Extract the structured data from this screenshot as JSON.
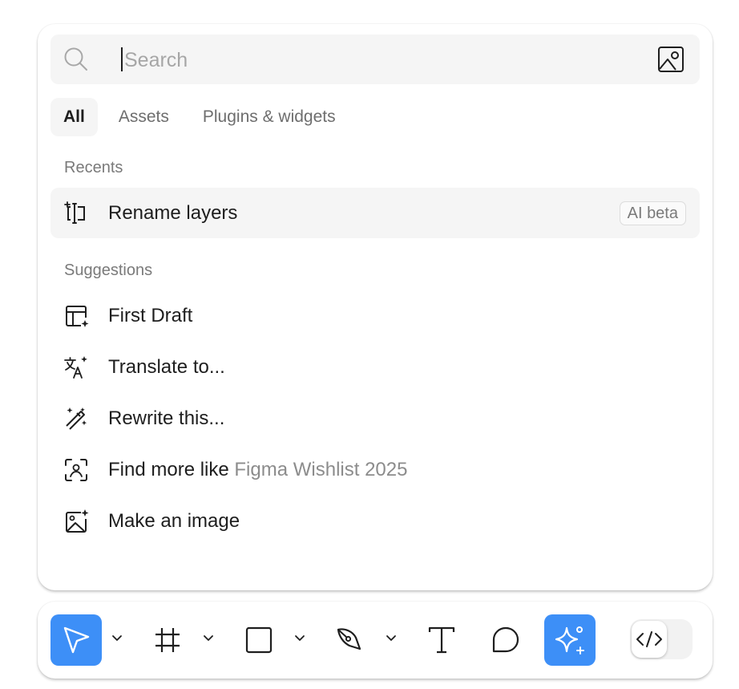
{
  "search": {
    "placeholder": "Search",
    "value": "",
    "leading_icon": "search-icon",
    "trailing_icon": "image-search-icon"
  },
  "tabs": [
    {
      "label": "All",
      "active": true
    },
    {
      "label": "Assets",
      "active": false
    },
    {
      "label": "Plugins & widgets",
      "active": false
    }
  ],
  "recents": {
    "label": "Recents",
    "items": [
      {
        "label": "Rename layers",
        "icon": "rename-text-icon",
        "badge": "AI beta",
        "highlighted": true
      }
    ]
  },
  "suggestions": {
    "label": "Suggestions",
    "items": [
      {
        "label": "First Draft",
        "icon": "layout-sparkle-icon"
      },
      {
        "label": "Translate to...",
        "icon": "translate-icon"
      },
      {
        "label": "Rewrite this...",
        "icon": "magic-wand-icon"
      },
      {
        "label": "Find more like",
        "sublabel": "Figma Wishlist 2025",
        "icon": "scan-icon"
      },
      {
        "label": "Make an image",
        "icon": "image-sparkle-icon"
      }
    ]
  },
  "toolbar": {
    "tools": [
      {
        "name": "move-tool",
        "icon": "cursor-arrow-icon",
        "active": true,
        "has_menu": true
      },
      {
        "name": "frame-tool",
        "icon": "frame-hash-icon",
        "active": false,
        "has_menu": true
      },
      {
        "name": "shape-tool",
        "icon": "rectangle-icon",
        "active": false,
        "has_menu": true
      },
      {
        "name": "pen-tool",
        "icon": "pen-nib-icon",
        "active": false,
        "has_menu": true
      },
      {
        "name": "text-tool",
        "icon": "text-t-icon",
        "active": false,
        "has_menu": false
      },
      {
        "name": "comment-tool",
        "icon": "comment-bubble-icon",
        "active": false,
        "has_menu": false
      },
      {
        "name": "actions-tool",
        "icon": "ai-sparkle-icon",
        "active": true,
        "has_menu": false
      }
    ],
    "dev_mode_toggle": {
      "icon": "code-brackets-icon",
      "on": false
    }
  },
  "colors": {
    "accent": "#3d8ff7",
    "row_highlight": "#f5f5f5",
    "muted_text": "#7a7a7a",
    "text": "#1e1e1e"
  }
}
